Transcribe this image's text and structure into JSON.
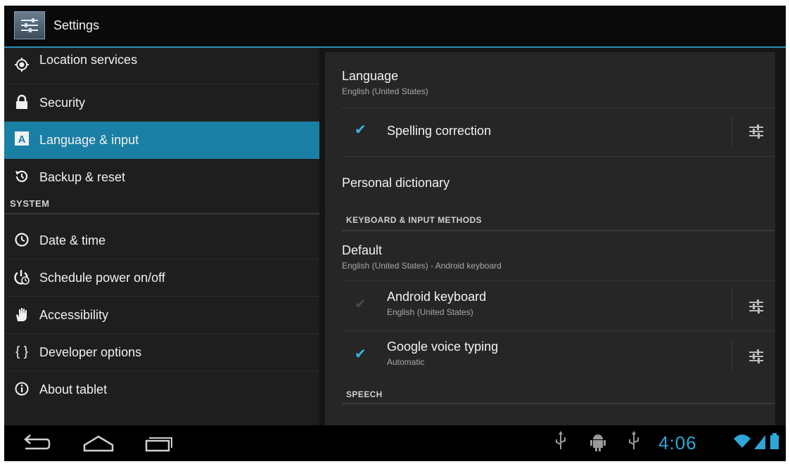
{
  "app": {
    "title": "Settings"
  },
  "sidebar": {
    "items": [
      {
        "label": "Location services",
        "icon": "location-icon"
      },
      {
        "label": "Security",
        "icon": "lock-icon"
      },
      {
        "label": "Language & input",
        "icon": "language-icon",
        "selected": true
      },
      {
        "label": "Backup & reset",
        "icon": "backup-icon"
      }
    ],
    "system_header": "SYSTEM",
    "system_items": [
      {
        "label": "Date & time",
        "icon": "clock-icon"
      },
      {
        "label": "Schedule power on/off",
        "icon": "power-schedule-icon"
      },
      {
        "label": "Accessibility",
        "icon": "hand-icon"
      },
      {
        "label": "Developer options",
        "icon": "braces-icon"
      },
      {
        "label": "About tablet",
        "icon": "info-icon"
      }
    ]
  },
  "main": {
    "language": {
      "title": "Language",
      "summary": "English (United States)"
    },
    "spelling": {
      "title": "Spelling correction",
      "checked": true
    },
    "dictionary": {
      "title": "Personal dictionary"
    },
    "keyboard_header": "KEYBOARD & INPUT METHODS",
    "default": {
      "title": "Default",
      "summary": "English (United States) - Android keyboard"
    },
    "android_keyboard": {
      "title": "Android keyboard",
      "summary": "English (United States)",
      "checked": true,
      "enabled": false
    },
    "voice_typing": {
      "title": "Google voice typing",
      "summary": "Automatic",
      "checked": true
    },
    "speech_header": "SPEECH"
  },
  "status_bar": {
    "time": "4:06",
    "accent": "#2ea7d8"
  },
  "colors": {
    "selected": "#1a7fa4",
    "accent_line": "#2a8fb8"
  }
}
